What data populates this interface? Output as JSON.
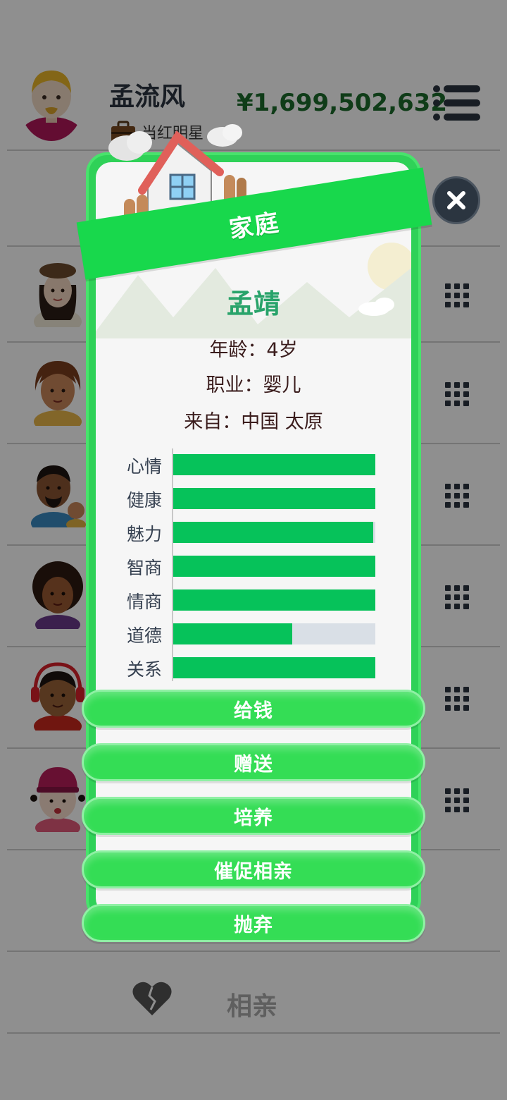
{
  "player": {
    "name": "孟流风",
    "job": "当红明星",
    "money": "¥1,699,502,632"
  },
  "family_list": [
    {
      "avatar": "beret-woman-avatar"
    },
    {
      "avatar": "woman-avatar"
    },
    {
      "avatar": "father-with-child-avatar"
    },
    {
      "avatar": "curly-hair-woman-avatar"
    },
    {
      "avatar": "headphones-boy-avatar"
    },
    {
      "avatar": "beanie-girl-avatar"
    }
  ],
  "bottom_bar": {
    "label": "相亲"
  },
  "modal": {
    "title": "家庭",
    "member": {
      "name": "孟靖",
      "age_line": "年龄：4岁",
      "job_line": "职业：婴儿",
      "origin_line": "来自：中国 太原"
    },
    "stats": [
      {
        "label": "心情",
        "value": 100
      },
      {
        "label": "健康",
        "value": 100
      },
      {
        "label": "魅力",
        "value": 99
      },
      {
        "label": "智商",
        "value": 100
      },
      {
        "label": "情商",
        "value": 100
      },
      {
        "label": "道德",
        "value": 59
      },
      {
        "label": "关系",
        "value": 100
      }
    ],
    "actions": [
      {
        "label": "给钱"
      },
      {
        "label": "赠送"
      },
      {
        "label": "培养"
      },
      {
        "label": "催促相亲"
      },
      {
        "label": "抛弃"
      }
    ]
  },
  "colors": {
    "accent_green": "#18d84c",
    "stat_fill": "#06c25a",
    "name_green": "#28a36a",
    "money_green": "#1c6b2c"
  }
}
